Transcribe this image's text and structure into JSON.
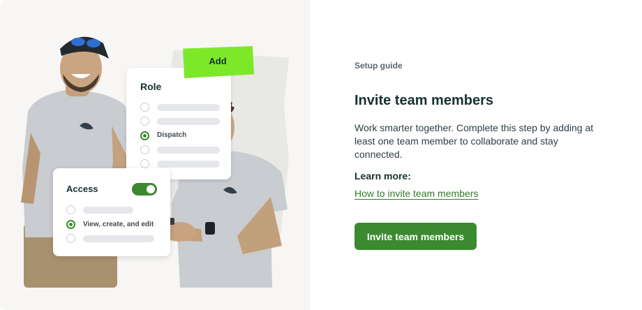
{
  "illustration": {
    "add_tag": "Add",
    "role_card": {
      "title": "Role",
      "selected_option": "Dispatch"
    },
    "access_card": {
      "title": "Access",
      "toggle_on": true,
      "selected_option": "View, create, and edit"
    }
  },
  "content": {
    "eyebrow": "Setup guide",
    "title": "Invite team members",
    "description": "Work smarter together. Complete this step by adding at least one team member to collaborate and stay connected.",
    "learn_more_label": "Learn more:",
    "learn_more_link": "How to invite team members",
    "cta_label": "Invite team members"
  },
  "colors": {
    "accent_green": "#3b8a2f",
    "tape_green": "#7de82a",
    "panel_bg": "#f7f6f4",
    "heading": "#16302f"
  }
}
